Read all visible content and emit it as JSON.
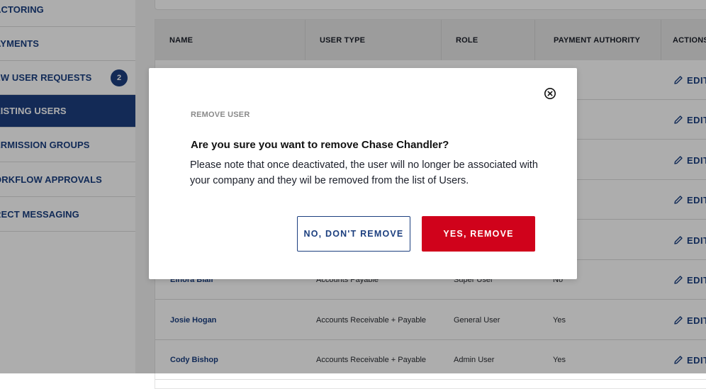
{
  "sidebar": {
    "items": [
      {
        "label": "ACTORING"
      },
      {
        "label": "AYMENTS"
      },
      {
        "label": "EW USER REQUESTS",
        "badge": "2"
      },
      {
        "label": "XISTING USERS"
      },
      {
        "label": "ERMISSION GROUPS"
      },
      {
        "label": "ORKFLOW APPROVALS"
      },
      {
        "label": "RECT MESSAGING"
      }
    ],
    "active_item": "XISTING USERS"
  },
  "table": {
    "columns": [
      "NAME",
      "USER TYPE",
      "ROLE",
      "PAYMENT AUTHORITY",
      "ACTIONS"
    ],
    "rows": [
      {
        "name": "",
        "user_type": "",
        "role": "",
        "payment_authority": "",
        "action": "EDIT"
      },
      {
        "name": "",
        "user_type": "",
        "role": "",
        "payment_authority": "",
        "action": "EDIT"
      },
      {
        "name": "",
        "user_type": "",
        "role": "",
        "payment_authority": "",
        "action": "EDIT"
      },
      {
        "name": "",
        "user_type": "",
        "role": "",
        "payment_authority": "",
        "action": "EDIT"
      },
      {
        "name": "",
        "user_type": "",
        "role": "",
        "payment_authority": "",
        "action": "EDIT"
      },
      {
        "name": "Elnora Blair",
        "user_type": "Accounts Payable",
        "role": "Super User",
        "payment_authority": "No",
        "action": "EDIT"
      },
      {
        "name": "Josie Hogan",
        "user_type": "Accounts Receivable + Payable",
        "role": "General User",
        "payment_authority": "Yes",
        "action": "EDIT"
      },
      {
        "name": "Cody Bishop",
        "user_type": "Accounts Receivable + Payable",
        "role": "Admin User",
        "payment_authority": "Yes",
        "action": "EDIT"
      }
    ]
  },
  "modal": {
    "eyebrow": "REMOVE USER",
    "title": "Are you sure you want to remove Chase Chandler?",
    "body": "Please note that once deactivated, the user will no longer be associated with your company and they wil be removed from the list of Users.",
    "cancel_label": "NO, DON'T REMOVE",
    "confirm_label": "YES, REMOVE",
    "close_icon": "close-circle-icon"
  },
  "colors": {
    "brand_navy": "#1c3f7f",
    "danger_red": "#d0021b",
    "overlay": "rgba(0,0,0,0.32)"
  }
}
